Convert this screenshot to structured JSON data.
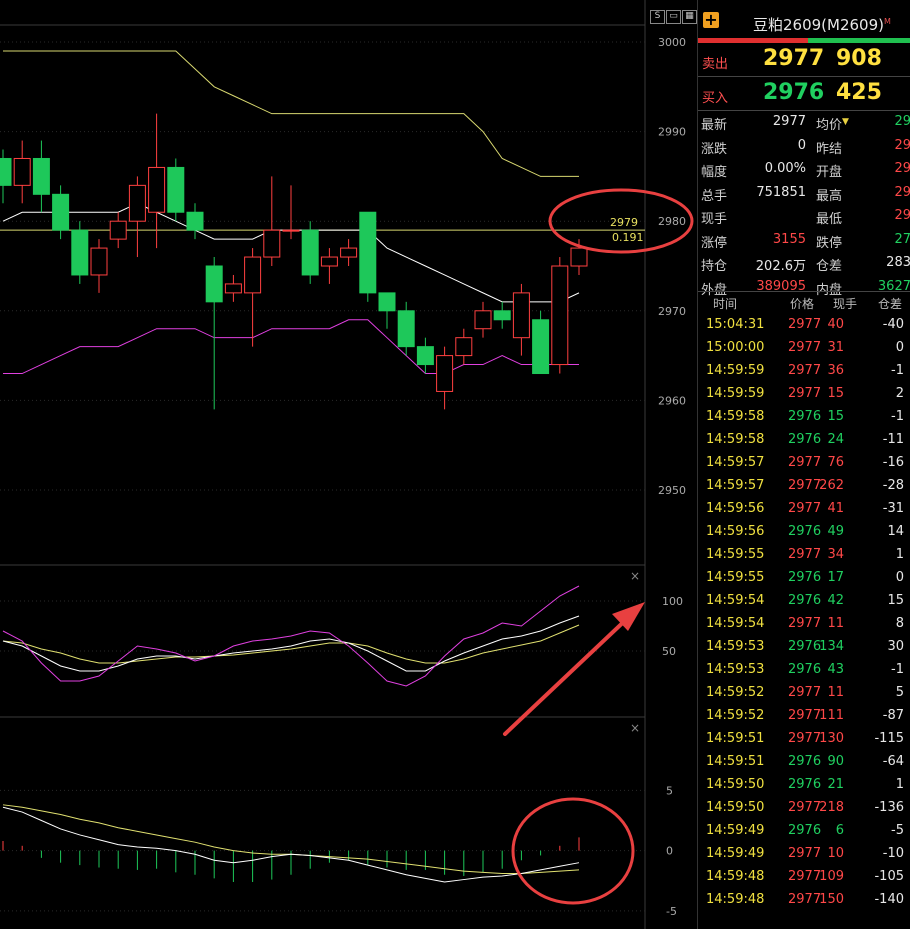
{
  "chart_data": {
    "type": "candlestick",
    "candles": [
      {
        "o": 2987,
        "c": 2984,
        "h": 2988,
        "l": 2982
      },
      {
        "o": 2984,
        "c": 2987,
        "h": 2989,
        "l": 2982
      },
      {
        "o": 2987,
        "c": 2983,
        "h": 2989,
        "l": 2981
      },
      {
        "o": 2983,
        "c": 2979,
        "h": 2984,
        "l": 2978
      },
      {
        "o": 2979,
        "c": 2974,
        "h": 2980,
        "l": 2973
      },
      {
        "o": 2974,
        "c": 2977,
        "h": 2978,
        "l": 2972
      },
      {
        "o": 2978,
        "c": 2980,
        "h": 2981,
        "l": 2977
      },
      {
        "o": 2980,
        "c": 2984,
        "h": 2985,
        "l": 2976
      },
      {
        "o": 2981,
        "c": 2986,
        "h": 2992,
        "l": 2977
      },
      {
        "o": 2986,
        "c": 2981,
        "h": 2987,
        "l": 2980
      },
      {
        "o": 2981,
        "c": 2979,
        "h": 2982,
        "l": 2978
      },
      {
        "o": 2975,
        "c": 2971,
        "h": 2976,
        "l": 2959
      },
      {
        "o": 2972,
        "c": 2973,
        "h": 2974,
        "l": 2971
      },
      {
        "o": 2972,
        "c": 2976,
        "h": 2977,
        "l": 2966
      },
      {
        "o": 2976,
        "c": 2979,
        "h": 2985,
        "l": 2975
      },
      {
        "o": 2979,
        "c": 2979,
        "h": 2984,
        "l": 2978
      },
      {
        "o": 2979,
        "c": 2974,
        "h": 2980,
        "l": 2973
      },
      {
        "o": 2975,
        "c": 2976,
        "h": 2977,
        "l": 2973
      },
      {
        "o": 2976,
        "c": 2977,
        "h": 2978,
        "l": 2975
      },
      {
        "o": 2981,
        "c": 2972,
        "h": 2981,
        "l": 2971
      },
      {
        "o": 2972,
        "c": 2970,
        "h": 2972,
        "l": 2968
      },
      {
        "o": 2970,
        "c": 2966,
        "h": 2971,
        "l": 2965
      },
      {
        "o": 2966,
        "c": 2964,
        "h": 2967,
        "l": 2963
      },
      {
        "o": 2961,
        "c": 2965,
        "h": 2966,
        "l": 2959
      },
      {
        "o": 2965,
        "c": 2967,
        "h": 2968,
        "l": 2964
      },
      {
        "o": 2968,
        "c": 2970,
        "h": 2971,
        "l": 2967
      },
      {
        "o": 2970,
        "c": 2969,
        "h": 2971,
        "l": 2968
      },
      {
        "o": 2967,
        "c": 2972,
        "h": 2973,
        "l": 2965
      },
      {
        "o": 2969,
        "c": 2963,
        "h": 2970,
        "l": 2963
      },
      {
        "o": 2964,
        "c": 2975,
        "h": 2976,
        "l": 2963
      },
      {
        "o": 2975,
        "c": 2977,
        "h": 2978,
        "l": 2974
      }
    ],
    "upper_band": [
      2999,
      2999,
      2999,
      2999,
      2999,
      2999,
      2999,
      2999,
      2999,
      2999,
      2997,
      2995,
      2994,
      2993,
      2992,
      2992,
      2992,
      2992,
      2992,
      2992,
      2992,
      2992,
      2992,
      2992,
      2992,
      2990,
      2987,
      2986,
      2985,
      2985,
      2985
    ],
    "mid_band": [
      2980,
      2981,
      2981,
      2981,
      2981,
      2981,
      2981,
      2982,
      2981,
      2980,
      2979,
      2978,
      2978,
      2978,
      2979,
      2979,
      2979,
      2979,
      2979,
      2979,
      2977,
      2976,
      2975,
      2974,
      2973,
      2972,
      2971,
      2971,
      2971,
      2971,
      2972
    ],
    "lower_band": [
      2963,
      2963,
      2964,
      2965,
      2966,
      2966,
      2966,
      2967,
      2968,
      2968,
      2968,
      2967,
      2967,
      2967,
      2968,
      2968,
      2968,
      2968,
      2969,
      2969,
      2967,
      2965,
      2963,
      2963,
      2964,
      2964,
      2965,
      2964,
      2964,
      2964,
      2964
    ],
    "ylim": [
      2944,
      3004
    ],
    "y_ticks": [
      3000,
      2990,
      2980,
      2970,
      2960,
      2950
    ],
    "current_price_label": "2979",
    "current_change_label": "0.191",
    "kdj": {
      "ylim": [
        -15,
        135
      ],
      "y_ticks": [
        100,
        50
      ],
      "k": [
        60,
        55,
        45,
        35,
        30,
        30,
        35,
        42,
        45,
        45,
        42,
        45,
        48,
        50,
        52,
        55,
        60,
        62,
        58,
        50,
        40,
        30,
        30,
        40,
        48,
        55,
        62,
        65,
        70,
        78,
        85
      ],
      "d": [
        60,
        58,
        52,
        48,
        42,
        38,
        38,
        40,
        42,
        44,
        44,
        45,
        46,
        48,
        50,
        52,
        55,
        58,
        58,
        55,
        48,
        42,
        38,
        38,
        42,
        48,
        52,
        56,
        60,
        68,
        76
      ],
      "j": [
        70,
        60,
        38,
        20,
        20,
        25,
        40,
        55,
        52,
        48,
        40,
        45,
        55,
        60,
        62,
        65,
        70,
        68,
        55,
        38,
        20,
        15,
        25,
        45,
        62,
        68,
        78,
        75,
        90,
        105,
        115
      ]
    },
    "macd": {
      "ylim": [
        -6.5,
        11
      ],
      "y_ticks": [
        5,
        0,
        -5
      ],
      "dif": [
        3.6,
        3.2,
        2.5,
        1.8,
        1.3,
        0.9,
        0.5,
        0.3,
        0.2,
        0.0,
        -0.3,
        -0.8,
        -1.0,
        -0.8,
        -0.5,
        -0.3,
        -0.4,
        -0.6,
        -0.8,
        -1.2,
        -1.6,
        -2.0,
        -2.3,
        -2.6,
        -2.4,
        -2.2,
        -2.1,
        -1.9,
        -1.6,
        -1.3,
        -1.0
      ],
      "dea": [
        3.8,
        3.6,
        3.3,
        3.0,
        2.6,
        2.3,
        1.9,
        1.6,
        1.3,
        1.0,
        0.7,
        0.3,
        0.0,
        -0.2,
        -0.3,
        -0.3,
        -0.4,
        -0.5,
        -0.6,
        -0.7,
        -0.9,
        -1.1,
        -1.3,
        -1.5,
        -1.7,
        -1.8,
        -1.9,
        -1.9,
        -1.8,
        -1.7,
        -1.6
      ],
      "hist": [
        0.8,
        0.4,
        -0.6,
        -1.0,
        -1.2,
        -1.4,
        -1.5,
        -1.6,
        -1.5,
        -1.8,
        -2.0,
        -2.3,
        -2.6,
        -2.6,
        -2.4,
        -2.0,
        -1.5,
        -1.0,
        -0.8,
        -1.2,
        -1.4,
        -1.6,
        -1.6,
        -2.0,
        -2.1,
        -1.8,
        -1.5,
        -0.8,
        -0.4,
        0.4,
        1.1
      ]
    },
    "colors": {
      "up": "#ff4040",
      "down": "#1ec85a",
      "band_outer": "#d8d870",
      "mid": "#ffffff",
      "lower": "#e040e0",
      "grid": "#2a2a2a",
      "annotation": "#e84040"
    }
  },
  "window_buttons": [
    "S"
  ],
  "quote": {
    "title": "豆粕2609(M2609)",
    "title_sup": "M",
    "sell_label": "卖出",
    "sell_price": "2977",
    "sell_vol": "908",
    "buy_label": "买入",
    "buy_price": "2976",
    "buy_vol": "425",
    "fields": [
      {
        "l": "最新",
        "v": "2977",
        "l2": "均价",
        "v2": "29",
        "arrow": "▼"
      },
      {
        "l": "涨跌",
        "v": "0",
        "l2": "昨结",
        "v2": "29"
      },
      {
        "l": "幅度",
        "v": "0.00%",
        "l2": "开盘",
        "v2": "29"
      },
      {
        "l": "总手",
        "v": "751851",
        "l2": "最高",
        "v2": "29"
      },
      {
        "l": "现手",
        "v": "",
        "l2": "最低",
        "v2": "29"
      },
      {
        "l": "涨停",
        "v": "3155",
        "l2": "跌停",
        "v2": "27"
      },
      {
        "l": "持仓",
        "v": "202.6万",
        "l2": "仓差",
        "v2": "283"
      },
      {
        "l": "外盘",
        "v": "389095",
        "l2": "内盘",
        "v2": "3627"
      }
    ]
  },
  "ticks_header": {
    "time": "时间",
    "price": "价格",
    "vol": "现手",
    "oi": "仓差"
  },
  "ticks": [
    {
      "t": "15:04:31",
      "p": "2977",
      "v": "40",
      "o": "-40"
    },
    {
      "t": "15:00:00",
      "p": "2977",
      "v": "31",
      "o": "0"
    },
    {
      "t": "14:59:59",
      "p": "2977",
      "v": "36",
      "o": "-1"
    },
    {
      "t": "14:59:59",
      "p": "2977",
      "v": "15",
      "o": "2"
    },
    {
      "t": "14:59:58",
      "p": "2976",
      "v": "15",
      "o": "-1"
    },
    {
      "t": "14:59:58",
      "p": "2976",
      "v": "24",
      "o": "-11"
    },
    {
      "t": "14:59:57",
      "p": "2977",
      "v": "76",
      "o": "-16"
    },
    {
      "t": "14:59:57",
      "p": "2977",
      "v": "262",
      "o": "-28"
    },
    {
      "t": "14:59:56",
      "p": "2977",
      "v": "41",
      "o": "-31"
    },
    {
      "t": "14:59:56",
      "p": "2976",
      "v": "49",
      "o": "14"
    },
    {
      "t": "14:59:55",
      "p": "2977",
      "v": "34",
      "o": "1"
    },
    {
      "t": "14:59:55",
      "p": "2976",
      "v": "17",
      "o": "0"
    },
    {
      "t": "14:59:54",
      "p": "2976",
      "v": "42",
      "o": "15"
    },
    {
      "t": "14:59:54",
      "p": "2977",
      "v": "11",
      "o": "8"
    },
    {
      "t": "14:59:53",
      "p": "2976",
      "v": "134",
      "o": "30"
    },
    {
      "t": "14:59:53",
      "p": "2976",
      "v": "43",
      "o": "-1"
    },
    {
      "t": "14:59:52",
      "p": "2977",
      "v": "11",
      "o": "5"
    },
    {
      "t": "14:59:52",
      "p": "2977",
      "v": "111",
      "o": "-87"
    },
    {
      "t": "14:59:51",
      "p": "2977",
      "v": "130",
      "o": "-115"
    },
    {
      "t": "14:59:51",
      "p": "2976",
      "v": "90",
      "o": "-64"
    },
    {
      "t": "14:59:50",
      "p": "2976",
      "v": "21",
      "o": "1"
    },
    {
      "t": "14:59:50",
      "p": "2977",
      "v": "218",
      "o": "-136"
    },
    {
      "t": "14:59:49",
      "p": "2976",
      "v": "6",
      "o": "-5"
    },
    {
      "t": "14:59:49",
      "p": "2977",
      "v": "10",
      "o": "-10"
    },
    {
      "t": "14:59:48",
      "p": "2977",
      "v": "109",
      "o": "-105"
    },
    {
      "t": "14:59:48",
      "p": "2977",
      "v": "150",
      "o": "-140"
    }
  ]
}
